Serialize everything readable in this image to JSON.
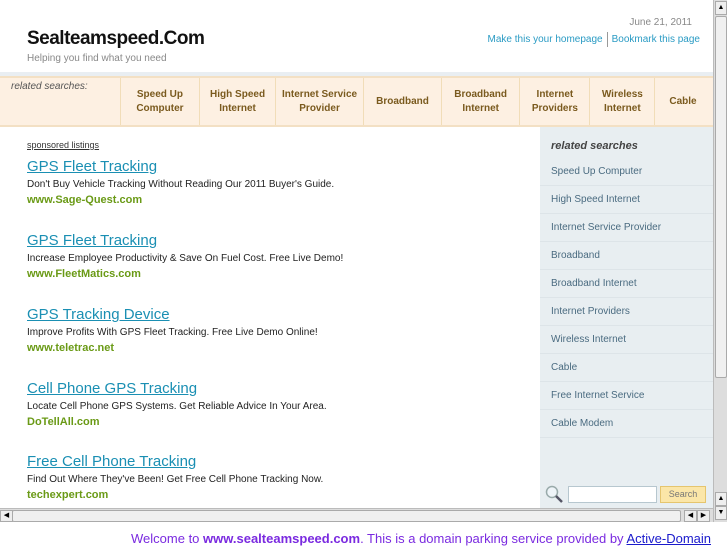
{
  "header": {
    "title": "Sealteamspeed.Com",
    "tagline": "Helping you find what you need",
    "date": "June 21, 2011",
    "homepage_link": "Make this your homepage",
    "bookmark_link": "Bookmark this page"
  },
  "nav": {
    "label": "related searches:",
    "items": [
      "Speed Up Computer",
      "High Speed Internet",
      "Internet Service Provider",
      "Broadband",
      "Broadband Internet",
      "Internet Providers",
      "Wireless Internet",
      "Cable"
    ]
  },
  "sponsored_label": "sponsored listings",
  "ads": [
    {
      "title": "GPS Fleet Tracking",
      "desc": "Don't Buy Vehicle Tracking Without Reading Our 2011 Buyer's Guide.",
      "url": "www.Sage-Quest.com"
    },
    {
      "title": "GPS Fleet Tracking",
      "desc": "Increase Employee Productivity & Save On Fuel Cost. Free Live Demo!",
      "url": "www.FleetMatics.com"
    },
    {
      "title": "GPS Tracking Device",
      "desc": "Improve Profits With GPS Fleet Tracking. Free Live Demo Online!",
      "url": "www.teletrac.net"
    },
    {
      "title": "Cell Phone GPS Tracking",
      "desc": "Locate Cell Phone GPS Systems. Get Reliable Advice In Your Area.",
      "url": "DoTellAll.com"
    },
    {
      "title": "Free Cell Phone Tracking",
      "desc": "Find Out Where They've Been! Get Free Cell Phone Tracking Now.",
      "url": "techexpert.com"
    }
  ],
  "sidebar": {
    "title": "related searches",
    "items": [
      "Speed Up Computer",
      "High Speed Internet",
      "Internet Service Provider",
      "Broadband",
      "Broadband Internet",
      "Internet Providers",
      "Wireless Internet",
      "Cable",
      "Free Internet Service",
      "Cable Modem"
    ],
    "search_button": "Search",
    "search_value": ""
  },
  "footer": {
    "prefix": "Welcome to ",
    "domain": "www.sealteamspeed.com",
    "middle": ". This is a domain parking service provided by ",
    "provider": "Active-Domain"
  }
}
